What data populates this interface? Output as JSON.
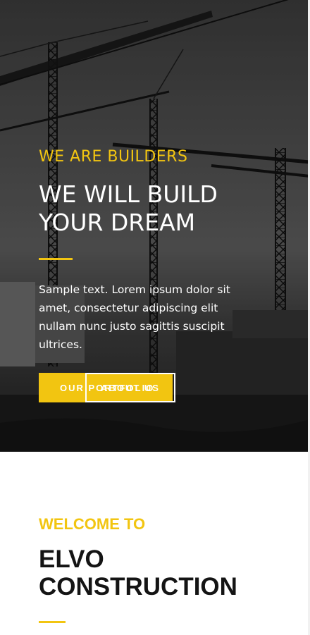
{
  "hero": {
    "eyebrow": "WE ARE BUILDERS",
    "headline": "WE WILL BUILD YOUR DREAM",
    "lead": "Sample text. Lorem ipsum dolor sit amet, consectetur adipiscing elit nullam nunc justo sagittis suscipit ultrices.",
    "primary_button": "OUR PORTFOLIO",
    "secondary_button": "ABOUT US",
    "background_image": "construction-cranes-photo"
  },
  "welcome": {
    "eyebrow": "WELCOME TO",
    "title": "ELVO CONSTRUCTION"
  },
  "colors": {
    "accent": "#f2c511",
    "dark_text": "#141414",
    "hero_bg": "#2b2b2b"
  }
}
